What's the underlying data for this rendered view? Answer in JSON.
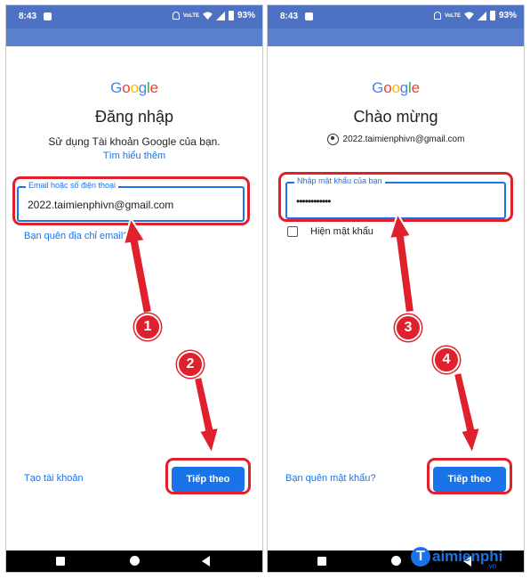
{
  "status_bar": {
    "time": "8:43",
    "network": "VoLTE",
    "battery": "93%"
  },
  "google": {
    "letters": [
      "G",
      "o",
      "o",
      "g",
      "l",
      "e"
    ],
    "colors": [
      "#4285F4",
      "#EA4335",
      "#FBBC05",
      "#4285F4",
      "#34A853",
      "#EA4335"
    ]
  },
  "left": {
    "title": "Đăng nhập",
    "subtitle": "Sử dụng Tài khoản Google của bạn.",
    "learn_more": "Tìm hiểu thêm",
    "email_label": "Email hoặc số điện thoại",
    "email_value": "2022.taimienphivn@gmail.com",
    "forgot_email": "Bạn quên địa chỉ email?",
    "create_account": "Tạo tài khoản",
    "next": "Tiếp theo"
  },
  "right": {
    "title": "Chào mừng",
    "account_email": "2022.taimienphivn@gmail.com",
    "password_label": "Nhập mật khẩu của bạn",
    "password_value": "••••••••••••",
    "show_password": "Hiện mật khẩu",
    "forgot_password": "Bạn quên mật khẩu?",
    "next": "Tiếp theo"
  },
  "steps": [
    "1",
    "2",
    "3",
    "4"
  ],
  "watermark": {
    "initial": "T",
    "name": "aimienphi",
    "tld": ".vn"
  },
  "colors": {
    "accent": "#1a73e8",
    "annotation": "#e0202c",
    "status_bar": "#4d72c4"
  }
}
